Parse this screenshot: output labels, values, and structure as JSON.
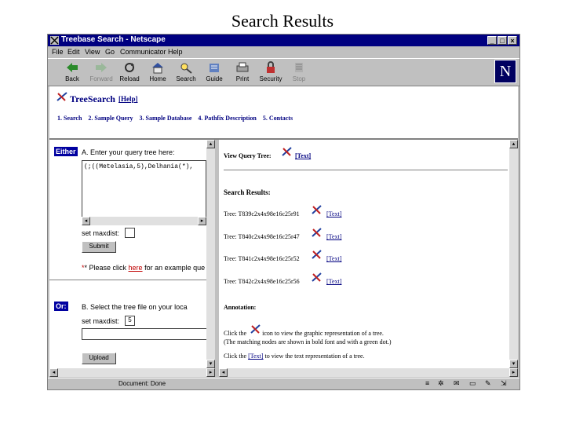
{
  "slide_title": "Search Results",
  "window": {
    "title": "Treebase Search - Netscape"
  },
  "menu": [
    "File",
    "Edit",
    "View",
    "Go",
    "Communicator",
    "Help"
  ],
  "toolbar": [
    {
      "label": "Back",
      "icon": "back-arrow-icon",
      "enabled": true
    },
    {
      "label": "Forward",
      "icon": "forward-arrow-icon",
      "enabled": false
    },
    {
      "label": "Reload",
      "icon": "reload-icon",
      "enabled": true
    },
    {
      "label": "Home",
      "icon": "home-icon",
      "enabled": true
    },
    {
      "label": "Search",
      "icon": "search-icon",
      "enabled": true
    },
    {
      "label": "Guide",
      "icon": "guide-icon",
      "enabled": true
    },
    {
      "label": "Print",
      "icon": "print-icon",
      "enabled": true
    },
    {
      "label": "Security",
      "icon": "security-lock-icon",
      "enabled": true
    },
    {
      "label": "Stop",
      "icon": "stop-icon",
      "enabled": false
    }
  ],
  "logo": "N",
  "treesearch": {
    "title": "TreeSearch",
    "help": "[Help]",
    "nav": [
      "1. Search",
      "2. Sample Query",
      "3. Sample Database",
      "4. Pathfix Description",
      "5. Contacts"
    ]
  },
  "left": {
    "either_label": "Either",
    "step_a": "A. Enter your query tree here:",
    "query_text": "(;((Metelasia,5),Delhania(*),",
    "set_maxdist": "set maxdist:",
    "maxdist_value": "",
    "submit": "Submit",
    "example_prefix": "* Please click ",
    "example_link": "here",
    "example_suffix": " for an example que",
    "or_label": "Or:",
    "step_b": "B. Select the tree file on your loca",
    "set_maxdist_b": "set maxdist:",
    "maxdist_b_value": "5",
    "upload": "Upload"
  },
  "right": {
    "view_query_tree": "View Query Tree:",
    "text_link": "[Text]",
    "search_results": "Search Results:",
    "results": [
      {
        "tree": "Tree: T839c2x4x98e16c25r91",
        "text": "[Text]"
      },
      {
        "tree": "Tree: T840c2x4x98e16c25r47",
        "text": "[Text]"
      },
      {
        "tree": "Tree: T841c2x4x98e16c25r52",
        "text": "[Text]"
      },
      {
        "tree": "Tree: T842c2x4x98e16c25r56",
        "text": "[Text]"
      }
    ],
    "annotation": "Annotation:",
    "anno_line1_prefix": "Click the",
    "anno_line1_suffix": "icon to view the graphic representation of a tree.",
    "anno_line2": "(The matching nodes are shown in bold font and with a green dot.)",
    "anno_line3_prefix": "Click the ",
    "anno_line3_link": "[Text]",
    "anno_line3_suffix": " to view the text representation of a tree."
  },
  "status": {
    "text": "Document: Done"
  },
  "colors": {
    "title_bar": "#000080",
    "link": "#000080",
    "chrome": "#c0c0c0"
  }
}
